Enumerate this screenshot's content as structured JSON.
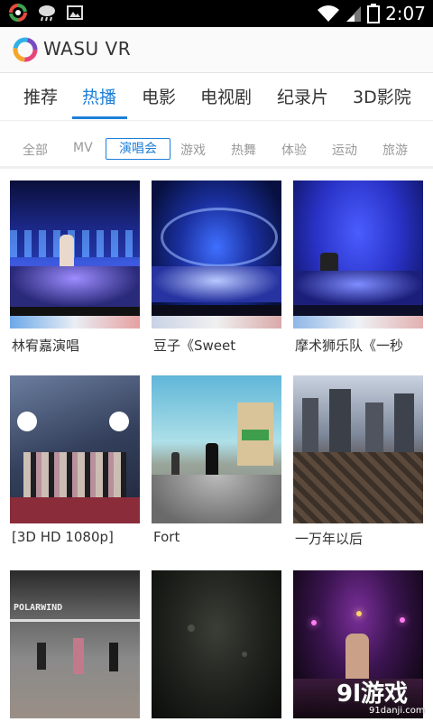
{
  "status_bar": {
    "time": "2:07",
    "battery_level": "2"
  },
  "app": {
    "title": "WASU VR"
  },
  "main_tabs": [
    "推荐",
    "热播",
    "电影",
    "电视剧",
    "纪录片",
    "3D影院"
  ],
  "main_tabs_selected": "热播",
  "sub_tabs": [
    "全部",
    "MV",
    "演唱会",
    "游戏",
    "热舞",
    "体验",
    "运动",
    "旅游"
  ],
  "sub_tabs_selected": "演唱会",
  "videos": [
    {
      "title": "林宥嘉演唱"
    },
    {
      "title": "豆子《Sweet"
    },
    {
      "title": "摩术狮乐队《一秒"
    },
    {
      "title": "[3D HD 1080p]"
    },
    {
      "title": "Fort"
    },
    {
      "title": "一万年以后"
    },
    {
      "title": ""
    },
    {
      "title": ""
    },
    {
      "title": ""
    }
  ],
  "thumb_text": {
    "polarwind": "POLARWIND"
  },
  "watermark": {
    "main": "9l游戏",
    "sub": "91danji.com"
  },
  "colors": {
    "accent": "#1d7fd8",
    "status_bar": "#000000"
  }
}
